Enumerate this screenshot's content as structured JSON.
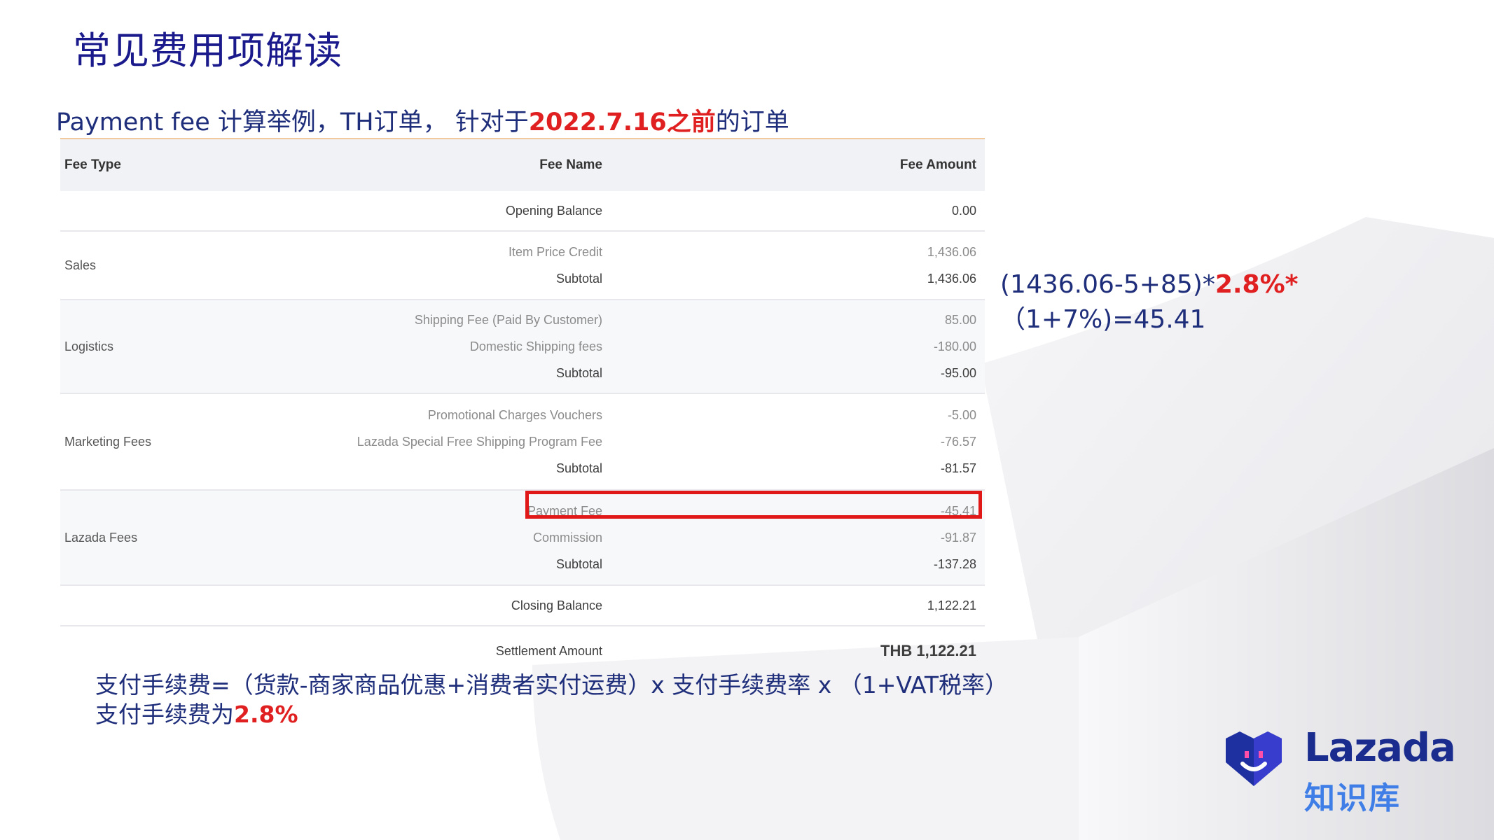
{
  "title": "常见费用项解读",
  "subtitle": {
    "prefix": "Payment fee 计算举例，TH订单， 针对于",
    "highlight": "2022.7.16之前",
    "suffix": "的订单"
  },
  "table": {
    "headers": {
      "type": "Fee Type",
      "name": "Fee Name",
      "amount": "Fee Amount"
    },
    "opening": {
      "name": "Opening Balance",
      "amount": "0.00"
    },
    "groups": [
      {
        "type": "Sales",
        "lines": [
          {
            "name": "Item Price Credit",
            "amount": "1,436.06"
          },
          {
            "name": "Subtotal",
            "amount": "1,436.06"
          }
        ]
      },
      {
        "type": "Logistics",
        "lines": [
          {
            "name": "Shipping Fee (Paid By Customer)",
            "amount": "85.00"
          },
          {
            "name": "Domestic Shipping fees",
            "amount": "-180.00"
          },
          {
            "name": "Subtotal",
            "amount": "-95.00"
          }
        ]
      },
      {
        "type": "Marketing Fees",
        "lines": [
          {
            "name": "Promotional Charges Vouchers",
            "amount": "-5.00"
          },
          {
            "name": "Lazada Special Free Shipping Program Fee",
            "amount": "-76.57"
          },
          {
            "name": "Subtotal",
            "amount": "-81.57"
          }
        ]
      },
      {
        "type": "Lazada Fees",
        "lines": [
          {
            "name": "Payment Fee",
            "amount": "-45.41"
          },
          {
            "name": "Commission",
            "amount": "-91.87"
          },
          {
            "name": "Subtotal",
            "amount": "-137.28"
          }
        ]
      }
    ],
    "closing": {
      "name": "Closing Balance",
      "amount": "1,122.21"
    },
    "settlement": {
      "name": "Settlement Amount",
      "amount": "THB 1,122.21"
    }
  },
  "formula": {
    "prefix": "(1436.06-5+85)*",
    "highlight": "2.8%*",
    "suffix": "（1+7%)=45.41"
  },
  "notes": {
    "line1": "支付手续费=（货款-商家商品优惠+消费者实付运费）x 支付手续费率 x （1+VAT税率）",
    "line2_prefix": "支付手续费为",
    "line2_highlight": "2.8%"
  },
  "logo": {
    "name": "Lazada",
    "sub": "知识库"
  },
  "colors": {
    "title": "#1a1a8c",
    "text": "#1f2e7a",
    "accent": "#e02020",
    "brand_dark": "#1a2d8f",
    "brand_light": "#3f7ee6",
    "settlement": "#2f63b5"
  }
}
